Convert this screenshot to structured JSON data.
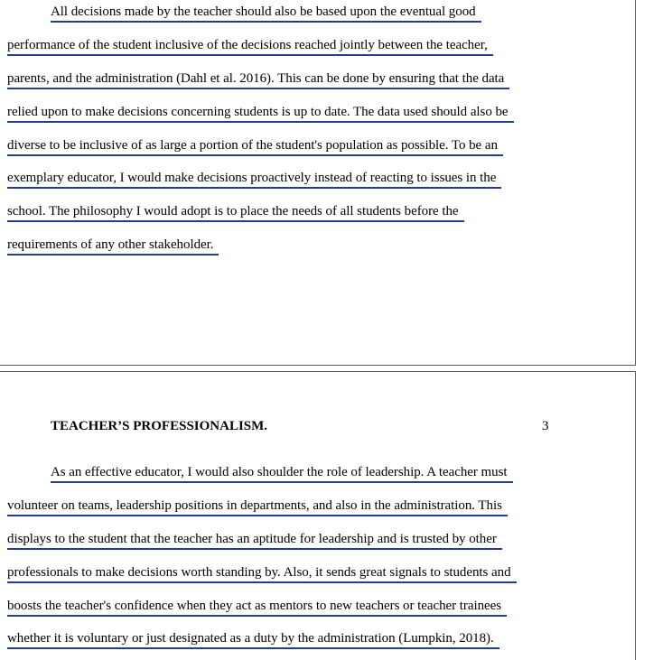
{
  "page1": {
    "paragraph_lines": [
      "All decisions made by the teacher should also be based upon the eventual good",
      "performance of the student inclusive of the decisions reached jointly between the teacher,",
      "parents, and the administration (Dahl et al. 2016). This can be done by ensuring that the data",
      "relied upon to make decisions concerning students is up to date. The data used should also be",
      "diverse to be inclusive of as large a portion of the student's population as possible. To be an",
      "exemplary educator, I would make decisions proactively instead of reacting to issues in the",
      "school. The philosophy I would adopt is to place the needs of all students before the",
      "requirements of any other stakeholder."
    ]
  },
  "page2": {
    "running_head": "TEACHER’S PROFESSIONALISM.",
    "page_number": "3",
    "paragraph_lines": [
      "As an effective educator, I would also shoulder the role of leadership. A teacher must",
      "volunteer on teams, leadership positions in departments, and also in the administration. This",
      "displays to the student that the teacher has an aptitude for leadership and is trusted by other",
      "professionals to make decisions worth standing by. Also, it sends great signals to students and",
      "boosts the teacher's confidence when they act as mentors to new teachers or teacher trainees",
      "whether it is voluntary or just designated as a duty by the administration (Lumpkin, 2018)."
    ]
  }
}
